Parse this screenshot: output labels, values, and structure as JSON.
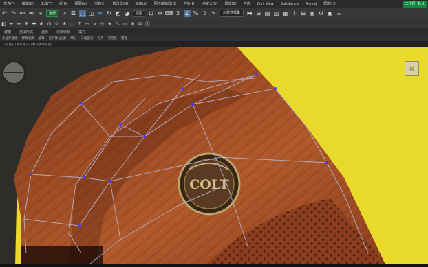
{
  "menubar": {
    "items": [
      "文件(F)",
      "编辑(E)",
      "工具(T)",
      "组(G)",
      "视图(V)",
      "创建(C)",
      "修改器(M)",
      "动画(A)",
      "图形编辑器(D)",
      "渲染(R)",
      "自定义(U)",
      "脚本(S)",
      "内容",
      "Civil View",
      "Substance",
      "Arnold",
      "帮助(H)"
    ],
    "workspace": "工作区: 默认"
  },
  "toolbar_main": {
    "selection_filter": "全部",
    "named_selection": "创建选择集",
    "snap_value": "3"
  },
  "toolbar_secondary": {
    "view_dropdown": "视图"
  },
  "ribbon": {
    "tabs": [
      "建模",
      "自由形式",
      "选择",
      "对象绘制",
      "填充"
    ]
  },
  "subribbon": {
    "items": [
      "多边形建模",
      "修改选择",
      "编辑",
      "几何体(全部)",
      "细分",
      "三角剖分",
      "对齐",
      "可见性",
      "属性"
    ]
  },
  "viewport": {
    "label": "[+] [前] [用户定义] [默认明暗处理]",
    "logo_text": "COLT",
    "cube_label": "前"
  },
  "colors": {
    "accent_green": "#0c8a3e",
    "background_yellow": "#e8d92a",
    "wood": "#8a3d1c",
    "wire": "#b8b8d8"
  }
}
